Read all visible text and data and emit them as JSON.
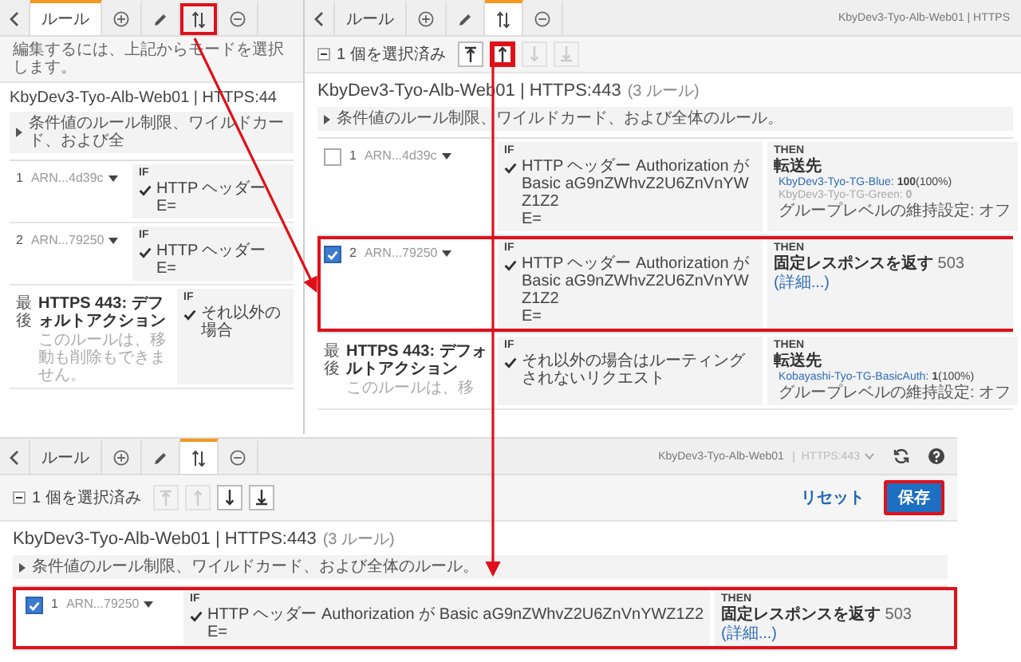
{
  "panels": [
    {
      "tabs": [
        {
          "kind": "back",
          "selected": false,
          "highlighted": false
        },
        {
          "kind": "text",
          "label": "ルール",
          "selected": true,
          "highlighted": false
        },
        {
          "kind": "add",
          "selected": false,
          "highlighted": false
        },
        {
          "kind": "edit",
          "selected": false,
          "highlighted": false
        },
        {
          "kind": "reorder",
          "selected": false,
          "highlighted": true
        },
        {
          "kind": "remove",
          "selected": false,
          "highlighted": false
        }
      ],
      "hint": "編集するには、上記からモードを選択します。",
      "title": "KbyDev3-Tyo-Alb-Web01 | HTTPS:44",
      "info": "条件値のルール制限、ワイルドカード、および全",
      "rules": [
        {
          "kind": "rule",
          "number": "1",
          "arn": "ARN...4d39c",
          "if_label": "IF",
          "condition_lines": [
            "HTTP ヘッダー",
            "E="
          ]
        },
        {
          "kind": "rule",
          "number": "2",
          "arn": "ARN...79250",
          "if_label": "IF",
          "condition_lines": [
            "HTTP ヘッダー",
            "E="
          ]
        },
        {
          "kind": "default",
          "number": "最後",
          "name": "HTTPS 443: デフォルトアクション",
          "note": "このルールは、移動も削除もできません。",
          "if_label": "IF",
          "condition_lines": [
            "それ以外の場合"
          ]
        }
      ]
    },
    {
      "tabs": [
        {
          "kind": "back",
          "selected": false,
          "highlighted": false
        },
        {
          "kind": "text",
          "label": "ルール",
          "selected": false,
          "highlighted": false
        },
        {
          "kind": "add",
          "selected": false,
          "highlighted": false
        },
        {
          "kind": "edit",
          "selected": false,
          "highlighted": false
        },
        {
          "kind": "reorder",
          "selected": true,
          "highlighted": false
        },
        {
          "kind": "remove",
          "selected": false,
          "highlighted": false
        }
      ],
      "header_title": "KbyDev3-Tyo-Alb-Web01 | HTTPS",
      "selection": "1 個を選択済み",
      "move_buttons": [
        {
          "kind": "top",
          "disabled": false,
          "highlighted": false
        },
        {
          "kind": "up",
          "disabled": false,
          "highlighted": true
        },
        {
          "kind": "down",
          "disabled": true,
          "highlighted": false
        },
        {
          "kind": "bottom",
          "disabled": true,
          "highlighted": false
        }
      ],
      "title": "KbyDev3-Tyo-Alb-Web01 | HTTPS:443",
      "count": "(3 ルール)",
      "info": "条件値のルール制限、ワイルドカード、および全体のルール。",
      "rules": [
        {
          "kind": "rule",
          "checked": false,
          "highlighted": false,
          "number": "1",
          "arn": "ARN...4d39c",
          "if_label": "IF",
          "condition_lines": [
            "HTTP ヘッダー Authorization が Basic aG9nZWhvZ2U6ZnVnYWZ1Z2",
            "E="
          ],
          "then": {
            "kind": "forward",
            "label": "THEN",
            "action": "転送先",
            "targets": [
              {
                "name": "KbyDev3-Tyo-TG-Blue:",
                "value": "100",
                "share": "(100%)",
                "active": true
              },
              {
                "name": "KbyDev3-Tyo-TG-Green:",
                "value": "0",
                "active": false
              }
            ],
            "stickiness": "グループレベルの維持設定: オフ"
          }
        },
        {
          "kind": "rule",
          "checked": true,
          "highlighted": true,
          "number": "2",
          "arn": "ARN...79250",
          "if_label": "IF",
          "condition_lines": [
            "HTTP ヘッダー Authorization が Basic aG9nZWhvZ2U6ZnVnYWZ1Z2",
            "E="
          ],
          "then": {
            "kind": "fixed",
            "label": "THEN",
            "action": "固定レスポンスを返す",
            "code": "503",
            "link": "(詳細...)"
          }
        },
        {
          "kind": "default",
          "number": "最後",
          "name": "HTTPS 443: デフォルトアクション",
          "note": "このルールは、移",
          "if_label": "IF",
          "condition_lines": [
            "それ以外の場合はルーティングされないリクエスト"
          ],
          "then": {
            "kind": "forward",
            "label": "THEN",
            "action": "転送先",
            "targets": [
              {
                "name": "Kobayashi-Tyo-TG-BasicAuth:",
                "value": "1",
                "share": "(100%)",
                "active": true
              }
            ],
            "stickiness": "グループレベルの維持設定: オフ"
          }
        }
      ]
    },
    {
      "tabs": [
        {
          "kind": "back",
          "selected": false,
          "highlighted": false
        },
        {
          "kind": "text",
          "label": "ルール",
          "selected": false,
          "highlighted": false
        },
        {
          "kind": "add",
          "selected": false,
          "highlighted": false
        },
        {
          "kind": "edit",
          "selected": false,
          "highlighted": false
        },
        {
          "kind": "reorder",
          "selected": true,
          "highlighted": false
        },
        {
          "kind": "remove",
          "selected": false,
          "highlighted": false
        }
      ],
      "header_title": "KbyDev3-Tyo-Alb-Web01",
      "header_sub": "HTTPS:443",
      "header_tools": [
        {
          "kind": "refresh"
        },
        {
          "kind": "help"
        }
      ],
      "selection": "1 個を選択済み",
      "move_buttons": [
        {
          "kind": "top",
          "disabled": true,
          "highlighted": false
        },
        {
          "kind": "up",
          "disabled": true,
          "highlighted": false
        },
        {
          "kind": "down",
          "disabled": false,
          "highlighted": false
        },
        {
          "kind": "bottom",
          "disabled": false,
          "highlighted": false
        }
      ],
      "reset_link": "リセット",
      "save_button": {
        "label": "保存",
        "highlighted": true
      },
      "title": "KbyDev3-Tyo-Alb-Web01 | HTTPS:443",
      "count": "(3 ルール)",
      "info": "条件値のルール制限、ワイルドカード、および全体のルール。",
      "rules": [
        {
          "kind": "rule",
          "checked": true,
          "highlighted": true,
          "number": "1",
          "arn": "ARN...79250",
          "if_label": "IF",
          "condition_lines": [
            "HTTP ヘッダー Authorization が Basic aG9nZWhvZ2U6ZnVnYWZ1Z2",
            "E="
          ],
          "then": {
            "kind": "fixed",
            "label": "THEN",
            "action": "固定レスポンスを返す",
            "code": "503",
            "link": "(詳細...)"
          }
        }
      ]
    }
  ]
}
